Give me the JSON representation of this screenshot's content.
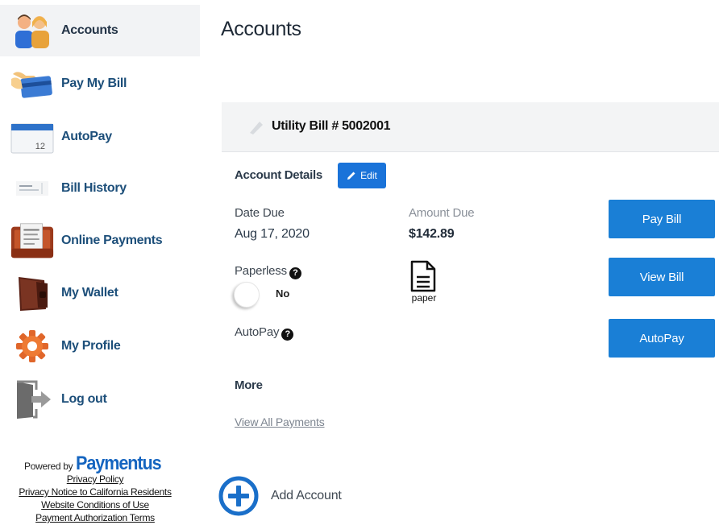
{
  "sidebar": {
    "items": [
      {
        "label": "Accounts",
        "icon": "users-icon"
      },
      {
        "label": "Pay My Bill",
        "icon": "credit-card-icon"
      },
      {
        "label": "AutoPay",
        "icon": "calendar-icon"
      },
      {
        "label": "Bill History",
        "icon": "receipt-icon"
      },
      {
        "label": "Online Payments",
        "icon": "payments-icon"
      },
      {
        "label": "My Wallet",
        "icon": "wallet-icon"
      },
      {
        "label": "My Profile",
        "icon": "gear-icon"
      },
      {
        "label": "Log out",
        "icon": "logout-icon"
      }
    ],
    "calendar_day": "12",
    "powered_by": "Powered by",
    "brand": "Paymentus",
    "links": [
      "Privacy Policy",
      "Privacy Notice to California Residents",
      "Website Conditions of Use",
      "Payment Authorization Terms"
    ]
  },
  "main": {
    "title": "Accounts",
    "bill_title": "Utility Bill # 5002001",
    "account_details_label": "Account Details",
    "edit_label": "Edit",
    "date_due_label": "Date Due",
    "date_due_value": "Aug 17, 2020",
    "amount_due_label": "Amount Due",
    "amount_due_value": "$142.89",
    "paperless_label": "Paperless",
    "paperless_value": "No",
    "paper_label": "paper",
    "autopay_label": "AutoPay",
    "more_label": "More",
    "view_all_payments": "View All Payments",
    "add_account": "Add Account",
    "buttons": {
      "pay_bill": "Pay Bill",
      "view_bill": "View Bill",
      "autopay": "AutoPay"
    }
  },
  "colors": {
    "accent": "#1a7fd6",
    "edit": "#1a73d9",
    "brand": "#1565c0",
    "nav_text": "#1d4f7a"
  }
}
